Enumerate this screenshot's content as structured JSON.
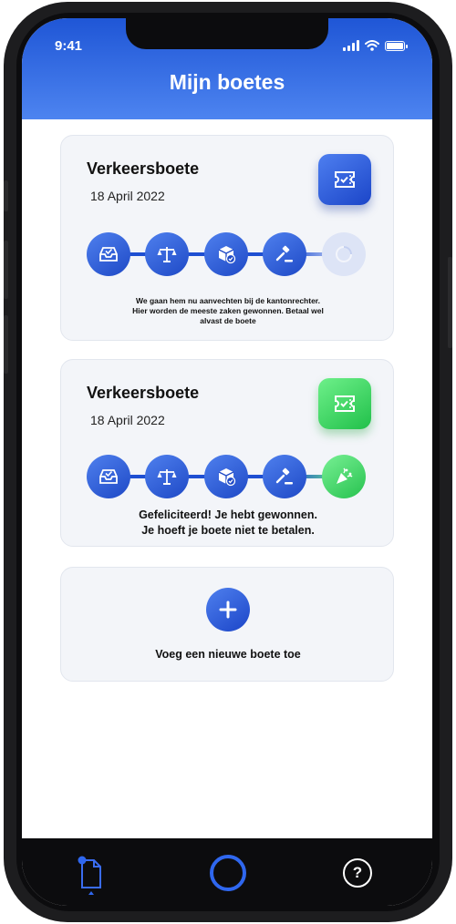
{
  "status": {
    "time": "9:41"
  },
  "header": {
    "title": "Mijn boetes"
  },
  "colors": {
    "primary": "#1e4fd2",
    "success": "#27c24f",
    "card_bg": "#f3f5f9"
  },
  "cards": [
    {
      "title": "Verkeersboete",
      "date": "18 April 2022",
      "badge_icon": "ticket-icon",
      "status_color": "blue",
      "steps": [
        "inbox-icon",
        "scales-icon",
        "package-icon",
        "gavel-icon",
        "loading-spinner-icon"
      ],
      "completed_steps": 4,
      "message_line1": "We gaan hem nu aanvechten bij de kantonrechter.",
      "message_line2": "Hier worden de meeste zaken gewonnen. Betaal wel",
      "message_line3": "alvast de boete"
    },
    {
      "title": "Verkeersboete",
      "date": "18 April 2022",
      "badge_icon": "ticket-icon",
      "status_color": "green",
      "steps": [
        "inbox-icon",
        "scales-icon",
        "package-icon",
        "gavel-icon",
        "party-popper-icon"
      ],
      "completed_steps": 5,
      "message_line1": "Gefeliciteerd! Je hebt gewonnen.",
      "message_line2": "Je hoeft je boete niet te betalen."
    }
  ],
  "add_card": {
    "label": "Voeg een nieuwe boete toe",
    "icon": "plus-icon"
  },
  "tabbar": {
    "help_glyph": "?"
  }
}
